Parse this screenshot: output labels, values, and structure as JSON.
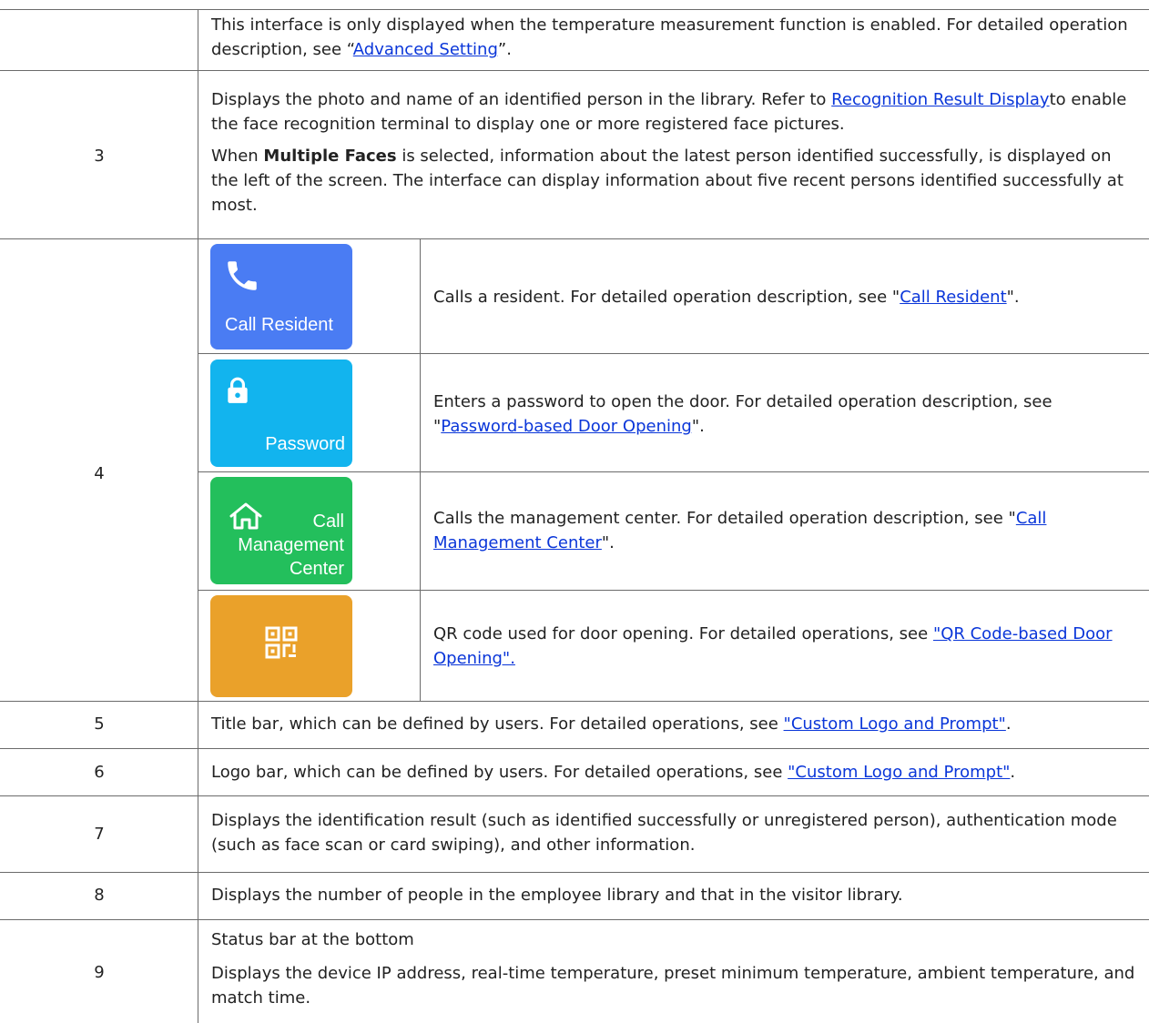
{
  "rows": {
    "r_top": {
      "text_before": "This interface is only displayed when the temperature measurement function is enabled. For detailed operation description, see “",
      "link": "Advanced Setting",
      "text_after": "”."
    },
    "r3": {
      "num": "3",
      "p1_before": "Displays the photo and name of an identified person in the library. Refer to ",
      "p1_link": "Recognition Result Display",
      "p1_after": "to enable the face recognition terminal to display one or more registered face pictures.",
      "p2_before": "When ",
      "p2_bold": "Multiple Faces",
      "p2_after": " is selected, information about the latest person identified successfully, is displayed on the left of the screen. The interface can display information about five recent persons identified successfully at most."
    },
    "r4": {
      "num": "4",
      "items": [
        {
          "button_label": "Call Resident",
          "icon": "phone-icon",
          "color": "#4a7cf3",
          "text_before": "Calls a resident. For detailed operation description, see \"",
          "link": "Call Resident",
          "text_after": "\"."
        },
        {
          "button_label": "Password",
          "icon": "lock-icon",
          "color": "#12b4ee",
          "text_before": "Enters a password to open the door. For detailed operation description, see \"",
          "link": "Password-based Door Opening",
          "text_after": "\"."
        },
        {
          "button_label_1": "Call",
          "button_label_2": "Management",
          "button_label_3": "Center",
          "icon": "home-icon",
          "color": "#23bf5c",
          "text_before": "Calls the management center. For detailed operation description, see \"",
          "link": "Call Management Center",
          "text_after": "\"."
        },
        {
          "icon": "qr-code-icon",
          "color": "#eaa12a",
          "text_before": "QR code used for door opening. For detailed operations, see ",
          "link": "\"QR Code-based Door Opening\".",
          "text_after": ""
        }
      ]
    },
    "r5": {
      "num": "5",
      "text_before": "Title bar, which can be defined by users. For detailed operations, see ",
      "link": "\"Custom Logo and Prompt\"",
      "text_after": "."
    },
    "r6": {
      "num": "6",
      "text_before": "Logo bar, which can be defined by users. For detailed operations, see ",
      "link": "\"Custom Logo and Prompt\"",
      "text_after": "."
    },
    "r7": {
      "num": "7",
      "text": "Displays the identification result (such as identified successfully or unregistered person), authentication mode (such as face scan or card swiping), and other information."
    },
    "r8": {
      "num": "8",
      "text": "Displays the number of people in the employee library and that in the visitor library."
    },
    "r9": {
      "num": "9",
      "p1": "Status bar at the bottom",
      "p2": "Displays the device IP address, real-time temperature, preset minimum temperature, ambient temperature, and match time."
    }
  }
}
